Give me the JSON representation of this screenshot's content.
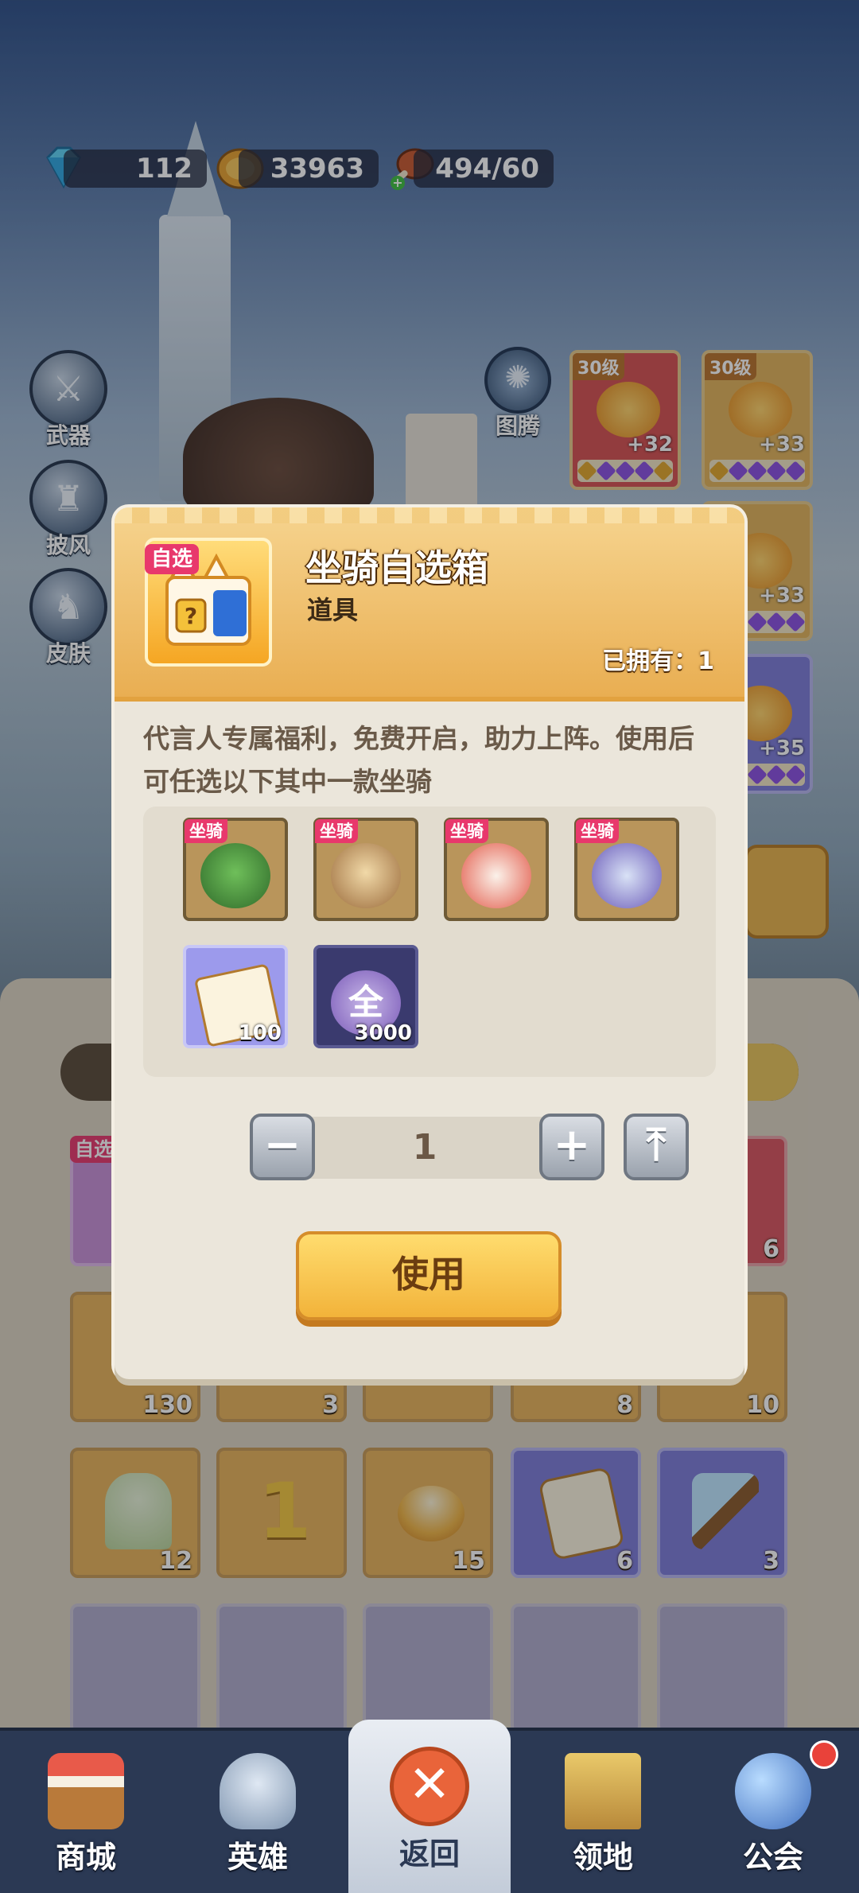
{
  "currency": {
    "gems": "112",
    "gold": "33963",
    "stamina": "494/60"
  },
  "side_menu": [
    {
      "label": "武器",
      "icon": "weapon-icon"
    },
    {
      "label": "披风",
      "icon": "cape-icon"
    },
    {
      "label": "皮肤",
      "icon": "skin-icon"
    }
  ],
  "totem": {
    "label": "图腾",
    "icon": "totem-icon"
  },
  "equipment": [
    {
      "level": "30级",
      "plus": "+32"
    },
    {
      "level": "30级",
      "plus": "+33"
    },
    {
      "level": "",
      "plus": "+33"
    },
    {
      "level": "",
      "plus": "+35"
    }
  ],
  "inventory": {
    "row1_counts": [
      "6"
    ],
    "row1_tag": "自选",
    "row2_counts": [
      "130",
      "3",
      "",
      "8",
      "10"
    ],
    "row3_counts": [
      "12",
      "",
      "15",
      "6",
      "3"
    ]
  },
  "modal": {
    "tag": "自选",
    "title": "坐骑自选箱",
    "subtitle": "道具",
    "owned": "已拥有：1",
    "description": "代言人专属福利，免费开启，助力上阵。使用后可任选以下其中一款坐骑",
    "choices": [
      {
        "tag": "坐骑",
        "icon": "green-beast-mount-icon",
        "count": ""
      },
      {
        "tag": "坐骑",
        "icon": "owl-mount-icon",
        "count": ""
      },
      {
        "tag": "坐骑",
        "icon": "lion-dance-mount-icon",
        "count": ""
      },
      {
        "tag": "坐骑",
        "icon": "wizard-rabbit-mount-icon",
        "count": ""
      },
      {
        "tag": "",
        "icon": "integral-ticket-icon",
        "count": "100"
      },
      {
        "tag": "",
        "icon": "all-coin-icon",
        "count": "3000",
        "glyph": "全"
      }
    ],
    "quantity": "1",
    "minus_label": "−",
    "plus_label": "+",
    "max_label": "⤒",
    "use_label": "使用"
  },
  "nav": [
    {
      "label": "商城",
      "icon": "shop-icon"
    },
    {
      "label": "英雄",
      "icon": "hero-helmet-icon"
    },
    {
      "label": "返回",
      "icon": "close-icon",
      "active": true
    },
    {
      "label": "领地",
      "icon": "castle-icon"
    },
    {
      "label": "公会",
      "icon": "guild-planet-icon"
    }
  ],
  "colors": {
    "accent": "#f2b33a",
    "tag": "#e8386c",
    "nav_bg": "#2b3954"
  }
}
